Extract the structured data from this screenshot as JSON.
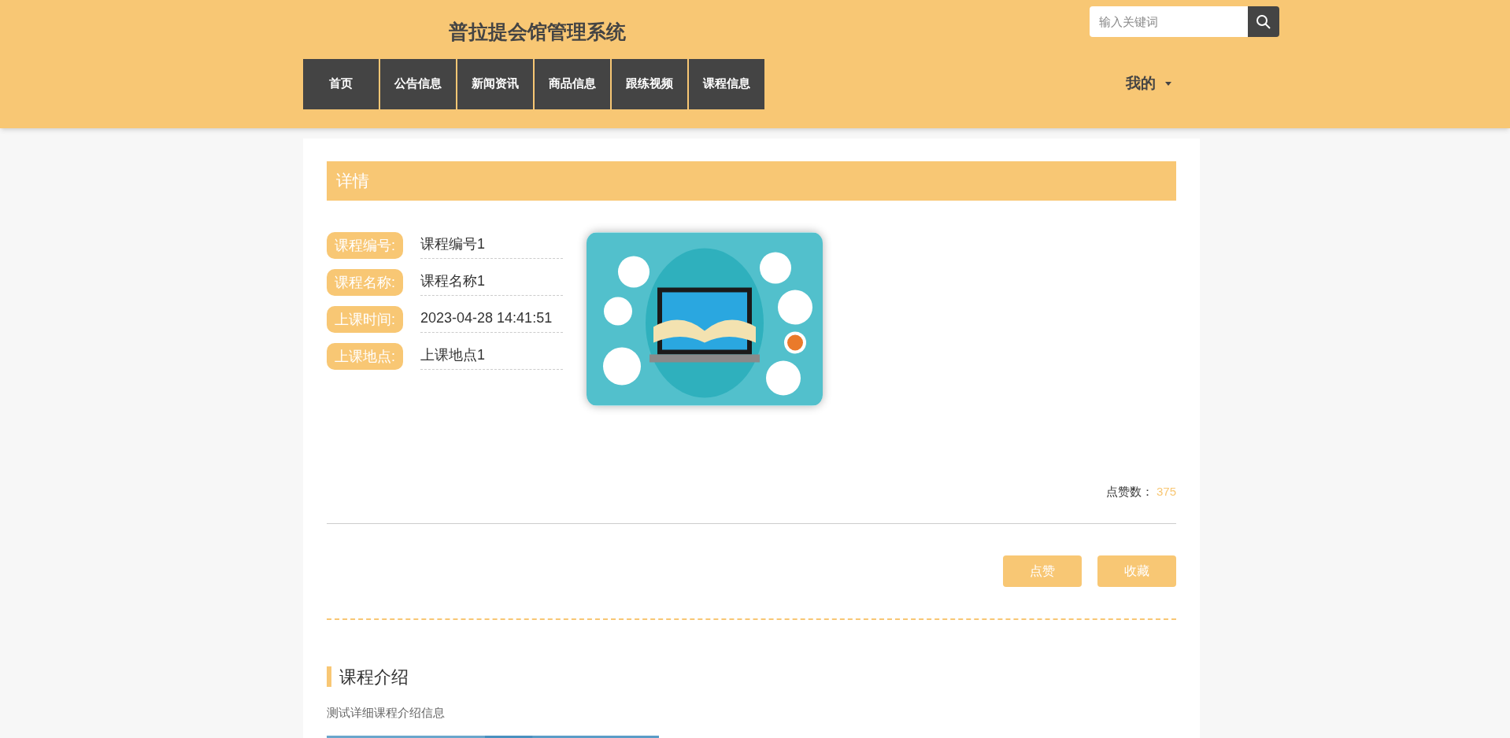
{
  "header": {
    "title": "普拉提会馆管理系统",
    "search": {
      "placeholder": "输入关键词"
    },
    "nav": [
      {
        "label": "首页",
        "selected": false
      },
      {
        "label": "公告信息",
        "selected": false
      },
      {
        "label": "新闻资讯",
        "selected": false
      },
      {
        "label": "商品信息",
        "selected": false
      },
      {
        "label": "跟练视频",
        "selected": false
      },
      {
        "label": "课程信息",
        "selected": false
      }
    ],
    "user_menu": "我的"
  },
  "detail": {
    "heading": "详情",
    "fields": [
      {
        "label": "课程编号:",
        "value": "课程编号1"
      },
      {
        "label": "课程名称:",
        "value": "课程名称1"
      },
      {
        "label": "上课时间:",
        "value": "2023-04-28 14:41:51"
      },
      {
        "label": "上课地点:",
        "value": "上课地点1"
      }
    ],
    "likes_label": "点赞数：",
    "likes_count": "375",
    "buttons": [
      "点赞",
      "收藏"
    ]
  },
  "intro": {
    "title": "课程介绍",
    "text": "测试详细课程介绍信息"
  }
}
